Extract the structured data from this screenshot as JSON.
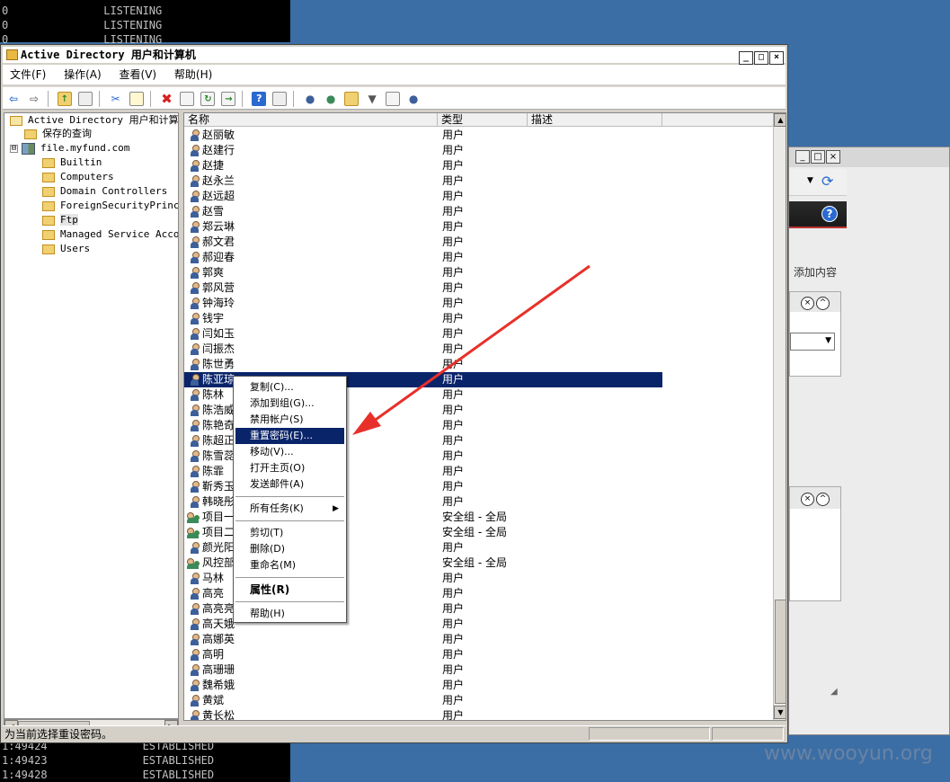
{
  "console": {
    "top_lines": [
      {
        "prefix": "0",
        "state": "LISTENING"
      },
      {
        "prefix": "0",
        "state": "LISTENING"
      },
      {
        "prefix": "0",
        "state": "LISTENING"
      }
    ],
    "bottom_lines": [
      {
        "prefix": "1:49424",
        "state": "ESTABLISHED"
      },
      {
        "prefix": "1:49423",
        "state": "ESTABLISHED"
      },
      {
        "prefix": "1:49428",
        "state": "ESTABLISHED"
      }
    ]
  },
  "background_window": {
    "add_content_label": "添加内容",
    "help_icon": "help-icon",
    "refresh_icon": "refresh-icon"
  },
  "window": {
    "title": "Active Directory 用户和计算机",
    "controls": {
      "minimize": "_",
      "maximize": "□",
      "close": "×"
    }
  },
  "menubar": {
    "file": "文件(F)",
    "action": "操作(A)",
    "view": "查看(V)",
    "help": "帮助(H)"
  },
  "toolbar_icons": [
    "back-arrow-icon",
    "forward-arrow-icon",
    "up-folder-icon",
    "show-hide-tree-icon",
    "cut-icon",
    "copy-icon",
    "delete-icon",
    "properties-icon",
    "refresh-icon",
    "export-icon",
    "help-icon",
    "console-icon",
    "new-user-icon",
    "new-group-icon",
    "new-ou-icon",
    "filter-icon",
    "find-icon",
    "add-to-group-icon"
  ],
  "tree": {
    "root": "Active Directory 用户和计算机",
    "saved_queries": "保存的查询",
    "domain": "file.myfund.com",
    "expander": "⊟",
    "items": [
      "Builtin",
      "Computers",
      "Domain Controllers",
      "ForeignSecurityPrincip",
      "Ftp",
      "Managed Service Accour",
      "Users"
    ]
  },
  "list": {
    "columns": {
      "name": "名称",
      "type": "类型",
      "description": "描述"
    },
    "rows": [
      {
        "name": "赵丽敏",
        "type": "用户",
        "kind": "user"
      },
      {
        "name": "赵建行",
        "type": "用户",
        "kind": "user"
      },
      {
        "name": "赵捷",
        "type": "用户",
        "kind": "user"
      },
      {
        "name": "赵永兰",
        "type": "用户",
        "kind": "user"
      },
      {
        "name": "赵远超",
        "type": "用户",
        "kind": "user"
      },
      {
        "name": "赵雪",
        "type": "用户",
        "kind": "user"
      },
      {
        "name": "郑云琳",
        "type": "用户",
        "kind": "user"
      },
      {
        "name": "郝文君",
        "type": "用户",
        "kind": "user"
      },
      {
        "name": "郝迎春",
        "type": "用户",
        "kind": "user"
      },
      {
        "name": "郭爽",
        "type": "用户",
        "kind": "user"
      },
      {
        "name": "郭风营",
        "type": "用户",
        "kind": "user"
      },
      {
        "name": "钟海玲",
        "type": "用户",
        "kind": "user"
      },
      {
        "name": "钱宇",
        "type": "用户",
        "kind": "user"
      },
      {
        "name": "闫如玉",
        "type": "用户",
        "kind": "user"
      },
      {
        "name": "闫振杰",
        "type": "用户",
        "kind": "user"
      },
      {
        "name": "陈世勇",
        "type": "用户",
        "kind": "user"
      },
      {
        "name": "陈亚琼",
        "type": "用户",
        "kind": "user",
        "selected": true
      },
      {
        "name": "陈林",
        "type": "用户",
        "kind": "user"
      },
      {
        "name": "陈浩威",
        "type": "用户",
        "kind": "user"
      },
      {
        "name": "陈艳奇",
        "type": "用户",
        "kind": "user"
      },
      {
        "name": "陈超正",
        "type": "用户",
        "kind": "user"
      },
      {
        "name": "陈雪蕊",
        "type": "用户",
        "kind": "user"
      },
      {
        "name": "陈霏",
        "type": "用户",
        "kind": "user"
      },
      {
        "name": "靳秀玉",
        "type": "用户",
        "kind": "user"
      },
      {
        "name": "韩晓彤",
        "type": "用户",
        "kind": "user"
      },
      {
        "name": "项目一",
        "type": "安全组 - 全局",
        "kind": "group"
      },
      {
        "name": "项目二",
        "type": "安全组 - 全局",
        "kind": "group"
      },
      {
        "name": "颜光阳",
        "type": "用户",
        "kind": "user"
      },
      {
        "name": "风控部",
        "type": "安全组 - 全局",
        "kind": "group"
      },
      {
        "name": "马林",
        "type": "用户",
        "kind": "user"
      },
      {
        "name": "高亮",
        "type": "用户",
        "kind": "user"
      },
      {
        "name": "高亮亮",
        "type": "用户",
        "kind": "user"
      },
      {
        "name": "高天娥",
        "type": "用户",
        "kind": "user"
      },
      {
        "name": "高娜英",
        "type": "用户",
        "kind": "user"
      },
      {
        "name": "高明",
        "type": "用户",
        "kind": "user"
      },
      {
        "name": "高珊珊",
        "type": "用户",
        "kind": "user"
      },
      {
        "name": "魏希娥",
        "type": "用户",
        "kind": "user"
      },
      {
        "name": "黄斌",
        "type": "用户",
        "kind": "user"
      },
      {
        "name": "黄长松",
        "type": "用户",
        "kind": "user"
      }
    ]
  },
  "context_menu": {
    "items": [
      {
        "label": "复制(C)...",
        "group": 1
      },
      {
        "label": "添加到组(G)...",
        "group": 1
      },
      {
        "label": "禁用帐户(S)",
        "group": 1
      },
      {
        "label": "重置密码(E)...",
        "group": 1,
        "highlighted": true
      },
      {
        "label": "移动(V)...",
        "group": 1
      },
      {
        "label": "打开主页(O)",
        "group": 1
      },
      {
        "label": "发送邮件(A)",
        "group": 1
      },
      {
        "label": "所有任务(K)",
        "group": 2,
        "submenu": true
      },
      {
        "label": "剪切(T)",
        "group": 3
      },
      {
        "label": "删除(D)",
        "group": 3
      },
      {
        "label": "重命名(M)",
        "group": 3
      },
      {
        "label": "属性(R)",
        "group": 4,
        "bold": true
      },
      {
        "label": "帮助(H)",
        "group": 5
      }
    ],
    "submenu_arrow": "▶"
  },
  "statusbar": {
    "text": "为当前选择重设密码。"
  },
  "annotation": {
    "arrow_color": "#e8302a"
  },
  "watermark": "www.wooyun.org"
}
